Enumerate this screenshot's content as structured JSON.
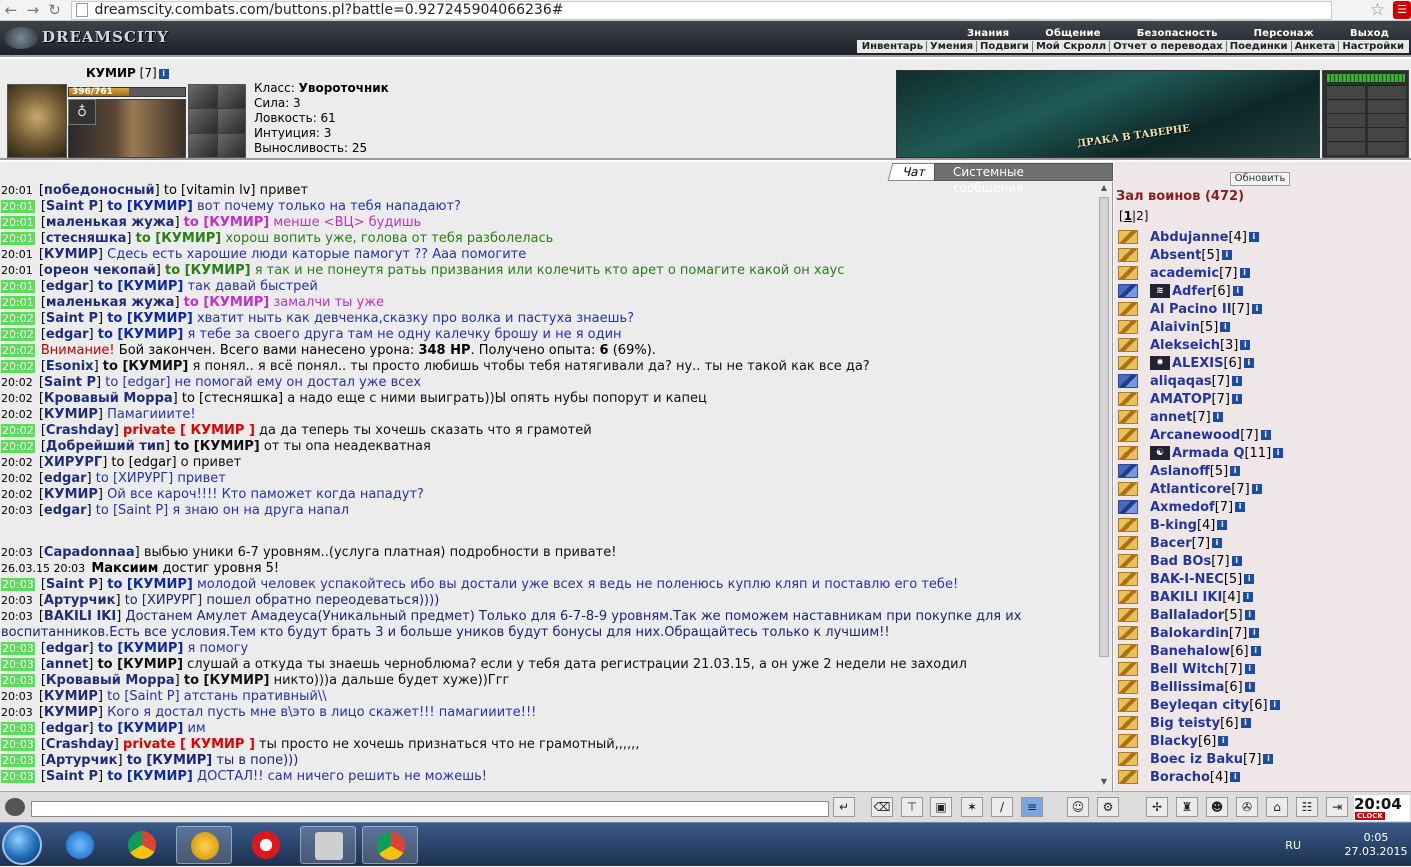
{
  "browser": {
    "url": "dreamscity.combats.com/buttons.pl?battle=0.927245904066236#"
  },
  "header": {
    "logo": "DREAMSCITY",
    "top_menu": [
      "Знания",
      "Общение",
      "Безопасность",
      "Персонаж",
      "Выход"
    ],
    "sub_menu": [
      "Инвентарь",
      "Умения",
      "Подвиги",
      "Мой Скролл",
      "Отчет о переводах",
      "Поединки",
      "Анкета",
      "Настройки"
    ]
  },
  "character": {
    "name": "КУМИР",
    "level": "[7]",
    "hp_text": "396/761",
    "hp_fraction": 0.52,
    "stats": {
      "class_label": "Класс:",
      "class_value": "Увороточник",
      "strength": "Сила: 3",
      "agility": "Ловкость: 61",
      "intuition": "Интуиция: 3",
      "endurance": "Выносливость: 25"
    },
    "tavern_caption": "ДРАКА В ТАВЕРНЕ"
  },
  "chat": {
    "tabs": [
      "Чат",
      "Системные сообщения"
    ],
    "messages": [
      {
        "time": "20:01",
        "hl": false,
        "nick": "победоносный",
        "to": "to [vitamin lv]",
        "text": " привет",
        "cls": "c-dark",
        "to_cls": "nm"
      },
      {
        "time": "20:01",
        "hl": true,
        "nick": "Saint P",
        "to": "to [КУМИР]",
        "text": " вот почему только на тебя нападают?",
        "cls": "c-blue",
        "to_cls": "to"
      },
      {
        "time": "20:01",
        "hl": true,
        "nick": "маленькая жужа",
        "to": "to [КУМИР]",
        "text": " менше <ВЦ> будишь",
        "cls": "c-mag",
        "to_cls": "c-mag to"
      },
      {
        "time": "20:01",
        "hl": true,
        "nick": "стесняшка",
        "to": "to [КУМИР]",
        "text": " хорош вопить уже, голова от тебя разболелась",
        "cls": "c-green",
        "to_cls": "c-green to"
      },
      {
        "time": "20:01",
        "hl": false,
        "nick": "КУМИР",
        "to": "",
        "text": " Сдесь есть харошие люди каторые памогут ?? Ааа помогите",
        "cls": "c-blue",
        "to_cls": "to"
      },
      {
        "time": "20:01",
        "hl": false,
        "nick": "ореон чекопай",
        "to": "to [КУМИР]",
        "text": " я так и не понеутя ратьь призвания или колечить кто арет о помагите какой он хаус",
        "cls": "c-green",
        "to_cls": "c-green to"
      },
      {
        "time": "20:01",
        "hl": true,
        "nick": "edgar",
        "to": "to [КУМИР]",
        "text": " так давай быстрей",
        "cls": "c-blue",
        "to_cls": "to"
      },
      {
        "time": "20:01",
        "hl": true,
        "nick": "маленькая жужа",
        "to": "to [КУМИР]",
        "text": " замалчи ты уже",
        "cls": "c-mag",
        "to_cls": "c-mag to"
      },
      {
        "time": "20:02",
        "hl": true,
        "nick": "Saint P",
        "to": "to [КУМИР]",
        "text": " хватит ныть как девченка,сказку про волка и пастуха знаешь?",
        "cls": "c-blue",
        "to_cls": "to"
      },
      {
        "time": "20:02",
        "hl": true,
        "nick": "edgar",
        "to": "to [КУМИР]",
        "text": " я тебе за своего друга там не одну калечку брошу и не я один",
        "cls": "c-blue",
        "to_cls": "to"
      },
      {
        "time": "20:02",
        "hl": true,
        "nick": "",
        "to": "",
        "text": "",
        "cls": "c-dark",
        "to_cls": "nm",
        "system": true,
        "sys_red": "Внимание!",
        "sys_text": " Бой закончен. Всего вами нанесено урона: ",
        "sys_b1": "348 HP",
        "sys_text2": ". Получено опыта: ",
        "sys_b2": "6",
        "sys_text3": " (69%)."
      },
      {
        "time": "20:02",
        "hl": true,
        "nick": "Esonix",
        "to": "to [КУМИР]",
        "text": " я понял.. я всё понял.. ты просто любишь чтобы тебя натягивали да? ну.. ты не такой как все да?",
        "cls": "c-dark",
        "to_cls": "to c-dark"
      },
      {
        "time": "20:02",
        "hl": false,
        "nick": "Saint P",
        "to": "to [edgar]",
        "text": " не помогай ему он достал уже всех",
        "cls": "c-blue",
        "to_cls": "c-blue"
      },
      {
        "time": "20:02",
        "hl": false,
        "nick": "Кровавый Морра",
        "to": "to [стесняшка]",
        "text": " а надо еще с ними выиграть))Ы опять нубы попорут и капец",
        "cls": "c-dark",
        "to_cls": "nm"
      },
      {
        "time": "20:02",
        "hl": false,
        "nick": "КУМИР",
        "to": "",
        "text": " Памагииите!",
        "cls": "c-blue",
        "to_cls": "to"
      },
      {
        "time": "20:02",
        "hl": true,
        "nick": "Crashday",
        "to": "private [ КУМИР ]",
        "text": " да да теперь ты хочешь сказать что я грамотей",
        "cls": "c-dark",
        "to_cls": "pm"
      },
      {
        "time": "20:02",
        "hl": true,
        "nick": "Добрейший тип",
        "to": "to [КУМИР]",
        "text": " от ты опа неадекватная",
        "cls": "c-dark",
        "to_cls": "to c-dark"
      },
      {
        "time": "20:02",
        "hl": false,
        "nick": "ХИРУРГ",
        "to": "to [edgar]",
        "text": " о привет",
        "cls": "c-dark",
        "to_cls": "nm"
      },
      {
        "time": "20:02",
        "hl": false,
        "nick": "edgar",
        "to": "to [ХИРУРГ]",
        "text": " привет",
        "cls": "c-blue",
        "to_cls": "c-blue"
      },
      {
        "time": "20:02",
        "hl": false,
        "nick": "КУМИР",
        "to": "",
        "text": " Ой все кароч!!!! Кто паможет когда нападут?",
        "cls": "c-blue",
        "to_cls": "to"
      },
      {
        "time": "20:03",
        "hl": false,
        "nick": "edgar",
        "to": "to [Saint P]",
        "text": " я знаю он на друга напал",
        "cls": "c-blue",
        "to_cls": "c-blue"
      },
      {
        "time": "",
        "hl": false,
        "nick": "",
        "to": "",
        "text": "",
        "cls": "",
        "to_cls": "",
        "blank": true
      },
      {
        "time": "20:03",
        "hl": false,
        "nick": "Capadonnaa",
        "to": "",
        "text": " выбью уники 6-7 уровням..(услуга платная) подробности в привате!",
        "cls": "c-dark",
        "to_cls": "nm"
      },
      {
        "time": "26.03.15 20:03",
        "hl": false,
        "nick": "",
        "to": "",
        "text": "",
        "cls": "c-dark",
        "to_cls": "nm",
        "levelup": true,
        "lv_name": "Максиим",
        "lv_text": " достиг уровня 5!"
      },
      {
        "time": "20:03",
        "hl": true,
        "nick": "Saint P",
        "to": "to [КУМИР]",
        "text": " молодой человек успакойтесь ибо вы достали уже всех я ведь не поленюсь куплю кляп и поставлю его тебе!",
        "cls": "c-blue",
        "to_cls": "to"
      },
      {
        "time": "20:03",
        "hl": false,
        "nick": "Артурчик",
        "to": "to [ХИРУРГ]",
        "text": " пошел обратно переодеваться))))",
        "cls": "c-navy",
        "to_cls": "c-navy"
      },
      {
        "time": "20:03",
        "hl": false,
        "nick": "BAKILI IKI",
        "to": "",
        "text": " Достанем Амулет Амадеуса(Уникальный предмет) Только для 6-7-8-9 уровням.Так же поможем наставникам при покупке для их",
        "cls": "c-navy",
        "to_cls": "nm"
      },
      {
        "time": "",
        "hl": false,
        "nick": "",
        "to": "",
        "text": "",
        "cls": "c-navy",
        "to_cls": "nm",
        "cont": true,
        "cont_text": "воспитанников.Есть все условия.Тем кто будут брать 3 и больше уников будут бонусы для них.Обращайтесь только к лучшим!!"
      },
      {
        "time": "20:03",
        "hl": true,
        "nick": "edgar",
        "to": "to [КУМИР]",
        "text": " я помогу",
        "cls": "c-blue",
        "to_cls": "to"
      },
      {
        "time": "20:03",
        "hl": true,
        "nick": "annet",
        "to": "to [КУМИР]",
        "text": " слушай а откуда ты знаешь черноблюма? если у тебя дата регистрации 21.03.15, а он уже 2 недели не заходил",
        "cls": "c-dark",
        "to_cls": "to c-dark"
      },
      {
        "time": "20:03",
        "hl": true,
        "nick": "Кровавый Морра",
        "to": "to [КУМИР]",
        "text": " никто)))а дальше будет хуже))Ггг",
        "cls": "c-dark",
        "to_cls": "to c-dark"
      },
      {
        "time": "20:03",
        "hl": false,
        "nick": "КУМИР",
        "to": "to [Saint P]",
        "text": " атстань пративный\\\\",
        "cls": "c-blue",
        "to_cls": "c-blue"
      },
      {
        "time": "20:03",
        "hl": false,
        "nick": "КУМИР",
        "to": "",
        "text": " Кого я достал пусть мне в\\это в лицо скажет!!! памагииите!!!",
        "cls": "c-blue",
        "to_cls": "to"
      },
      {
        "time": "20:03",
        "hl": true,
        "nick": "edgar",
        "to": "to [КУМИР]",
        "text": " им",
        "cls": "c-blue",
        "to_cls": "to"
      },
      {
        "time": "20:03",
        "hl": true,
        "nick": "Crashday",
        "to": "private [ КУМИР ]",
        "text": " ты просто не хочешь признаться что не грамотный,,,,,,",
        "cls": "c-dark",
        "to_cls": "pm"
      },
      {
        "time": "20:03",
        "hl": true,
        "nick": "Артурчик",
        "to": "to [КУМИР]",
        "text": " ты в попе)))",
        "cls": "c-navy",
        "to_cls": "to c-navy"
      },
      {
        "time": "20:03",
        "hl": true,
        "nick": "Saint P",
        "to": "to [КУМИР]",
        "text": " ДОСТАЛ!! сам ничего решить не можешь!",
        "cls": "c-blue",
        "to_cls": "to"
      }
    ]
  },
  "hall": {
    "refresh": "Обновить",
    "title": "Зал воинов (472)",
    "pages_open": "[",
    "page1": "1",
    "pages_sep": "|",
    "page2": "2",
    "pages_close": "]",
    "players": [
      {
        "name": "Abdujanne",
        "lv": "[4]",
        "icon": "gold"
      },
      {
        "name": "Absent",
        "lv": "[5]",
        "icon": "gold"
      },
      {
        "name": "academic",
        "lv": "[7]",
        "icon": "gold"
      },
      {
        "name": "Adfer",
        "lv": "[6]",
        "icon": "blue",
        "extra": "≋"
      },
      {
        "name": "Al Pacino II",
        "lv": "[7]",
        "icon": "gold"
      },
      {
        "name": "Alaivin",
        "lv": "[5]",
        "icon": "gold"
      },
      {
        "name": "Alekseich",
        "lv": "[3]",
        "icon": "gold"
      },
      {
        "name": "ALEXIS",
        "lv": "[6]",
        "icon": "gold",
        "extra": "✸"
      },
      {
        "name": "aliqaqas",
        "lv": "[7]",
        "icon": "blue"
      },
      {
        "name": "AMATOP",
        "lv": "[7]",
        "icon": "gold"
      },
      {
        "name": "annet",
        "lv": "[7]",
        "icon": "gold"
      },
      {
        "name": "Arcanewood",
        "lv": "[7]",
        "icon": "gold"
      },
      {
        "name": "Armada Q",
        "lv": "[11]",
        "icon": "gold",
        "extra": "☯"
      },
      {
        "name": "Aslanoff",
        "lv": "[5]",
        "icon": "blue"
      },
      {
        "name": "Atlanticore",
        "lv": "[7]",
        "icon": "gold"
      },
      {
        "name": "Axmedof",
        "lv": "[7]",
        "icon": "blue"
      },
      {
        "name": "B-king",
        "lv": "[4]",
        "icon": "gold"
      },
      {
        "name": "Bacer",
        "lv": "[7]",
        "icon": "gold"
      },
      {
        "name": "Bad BOs",
        "lv": "[7]",
        "icon": "gold"
      },
      {
        "name": "BAK-I-NEC",
        "lv": "[5]",
        "icon": "gold"
      },
      {
        "name": "BAKILI IKI",
        "lv": "[4]",
        "icon": "gold"
      },
      {
        "name": "Ballalador",
        "lv": "[5]",
        "icon": "gold"
      },
      {
        "name": "Balokardin",
        "lv": "[7]",
        "icon": "gold"
      },
      {
        "name": "Banehalow",
        "lv": "[6]",
        "icon": "gold"
      },
      {
        "name": "Bell Witch",
        "lv": "[7]",
        "icon": "gold"
      },
      {
        "name": "Bellissima",
        "lv": "[6]",
        "icon": "gold"
      },
      {
        "name": "Beyleqan city",
        "lv": "[6]",
        "icon": "gold"
      },
      {
        "name": "Big teisty",
        "lv": "[6]",
        "icon": "gold"
      },
      {
        "name": "Blacky",
        "lv": "[6]",
        "icon": "gold"
      },
      {
        "name": "Boec iz Baku",
        "lv": "[7]",
        "icon": "gold"
      },
      {
        "name": "Boracho",
        "lv": "[4]",
        "icon": "gold"
      }
    ]
  },
  "toolbar": {
    "clock": "20:04",
    "clock_label": "CLOCK"
  },
  "taskbar": {
    "lang": "RU",
    "time": "0:05",
    "date": "27.03.2015"
  }
}
